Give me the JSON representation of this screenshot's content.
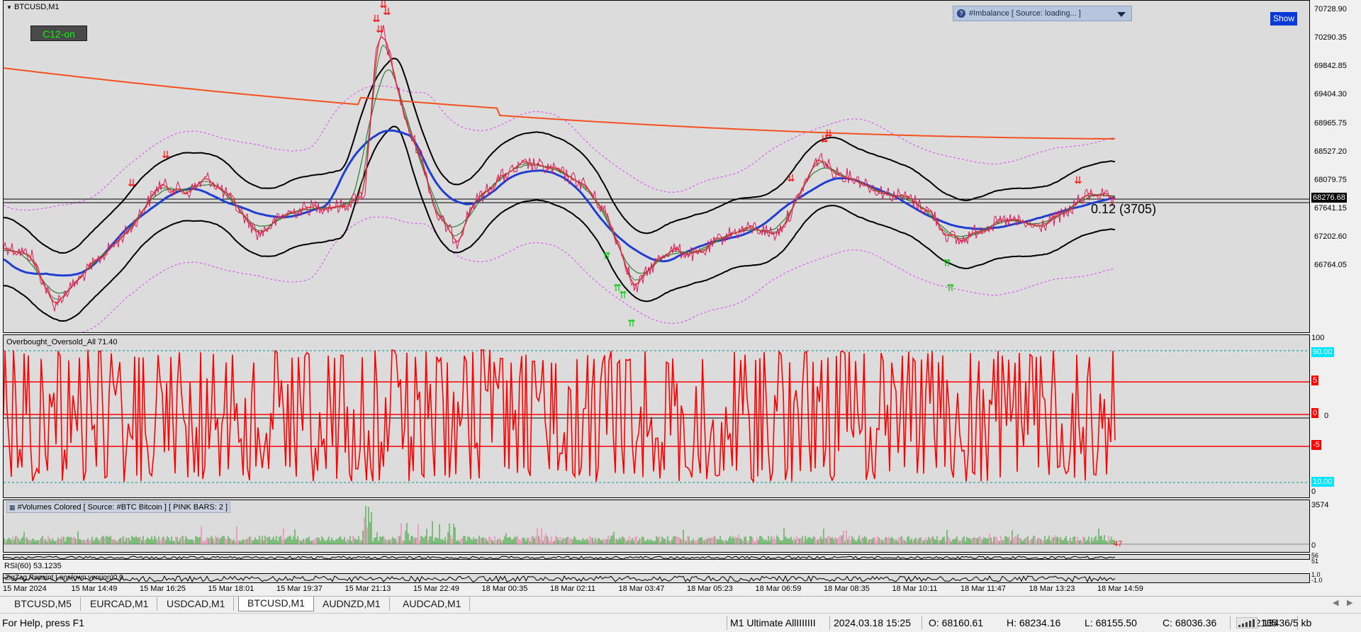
{
  "symbol_title": "BTCUSD,M1",
  "c12_button": "C12-on",
  "imbalance_indicator": "#Imbalance [ Source: loading... ]",
  "show_button": "Show",
  "level_label": "0.12 (3705)",
  "price_axis": {
    "ticks": [
      "70728.90",
      "70290.35",
      "69842.85",
      "69404.30",
      "68965.75",
      "68527.20",
      "68276.68",
      "68079.75",
      "67641.15",
      "67202.60",
      "66764.05"
    ],
    "current_price": "68276.68"
  },
  "oscillator": {
    "label": "Overbought_Oversold_All 71.40",
    "ticks": [
      "100",
      "0"
    ],
    "upper_level": "90.00",
    "lower_level": "10.00",
    "line_labels": [
      "5",
      "0",
      "-5"
    ],
    "right_mark": "0"
  },
  "volumes": {
    "label": "#Volumes Colored [ Source: #BTC Bitcoin ]  [ PINK BARS: 2 ]",
    "ticks": [
      "3574",
      "0"
    ],
    "last_value": "47"
  },
  "rsi": {
    "label": "RSI(60) 53.1235",
    "right_values": [
      "56",
      "51"
    ]
  },
  "zigzag": {
    "label": "ZigZag Repaint Lens(own version)0.0",
    "right_values": [
      "1.0",
      "-1.0"
    ]
  },
  "time_axis": [
    "15 Mar 2024",
    "15 Mar 14:49",
    "15 Mar 16:25",
    "15 Mar 18:01",
    "15 Mar 19:37",
    "15 Mar 21:13",
    "15 Mar 22:49",
    "18 Mar 00:35",
    "18 Mar 02:11",
    "18 Mar 03:47",
    "18 Mar 05:23",
    "18 Mar 06:59",
    "18 Mar 08:35",
    "18 Mar 10:11",
    "18 Mar 11:47",
    "18 Mar 13:23",
    "18 Mar 14:59"
  ],
  "tabs": [
    "BTCUSD,M5",
    "EURCAD,M1",
    "USDCAD,M1",
    "BTCUSD,M1",
    "AUDNZD,M1",
    "AUDCAD,M1"
  ],
  "active_tab": "BTCUSD,M1",
  "status": {
    "help": "For Help, press F1",
    "profile": "M1 Ultimate AllIIIIIII",
    "datetime": "2024.03.18 15:25",
    "open": "O: 68160.61",
    "high": "H: 68234.16",
    "low": "L: 68155.50",
    "close": "C: 68036.36",
    "volume": "V: 2185",
    "traffic": "13436/5 kb"
  },
  "colors": {
    "chart_bg": "#dcdcdc",
    "price_line": "#d81b60",
    "ema_fast": "#e53935",
    "ema_mid": "#2e7d32",
    "ema_blue": "#1e3fd0",
    "ema_orange": "#f4511e",
    "bands": "#000000",
    "envelope": "#e040fb",
    "oscillator": "#ff0000",
    "levels_cyan": "#009999",
    "volume_green": "#1b9e1b",
    "volume_pink": "#ff5fa8"
  },
  "icons": [
    "down-triangle-icon",
    "help-icon",
    "chevron-down-icon",
    "sell-arrow-icon",
    "buy-arrow-icon",
    "signal-bars-icon"
  ]
}
